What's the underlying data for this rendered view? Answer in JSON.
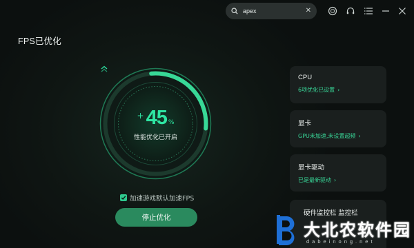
{
  "search": {
    "query": "apex",
    "clear_icon": "close-icon"
  },
  "top_icons": [
    "gamepad-icon",
    "headset-icon",
    "menu-icon",
    "minimize-icon",
    "close-icon"
  ],
  "page_title": "FPS已优化",
  "gauge": {
    "plus": "+",
    "value": "45",
    "unit": "%",
    "status": "性能优化已开启",
    "progress": 0.45
  },
  "checkbox": {
    "label": "加速游戏默认加速FPS",
    "checked": true
  },
  "stop_button": {
    "label": "停止优化"
  },
  "cards": [
    {
      "title": "CPU",
      "sub": "6项优化已设置"
    },
    {
      "title": "显卡",
      "sub": "GPU未加速,未设置超频"
    },
    {
      "title": "显卡驱动",
      "sub": "已是最新驱动"
    },
    {
      "title": "硬件监控栏 监控栏",
      "sub": ""
    }
  ],
  "card_arrow": "›",
  "watermark": {
    "text": "大北农软件园",
    "url": "dabeinong.net"
  },
  "colors": {
    "accent": "#2ee6a3",
    "button": "#2a8a5e",
    "card_bg": "#1a1f1e"
  }
}
